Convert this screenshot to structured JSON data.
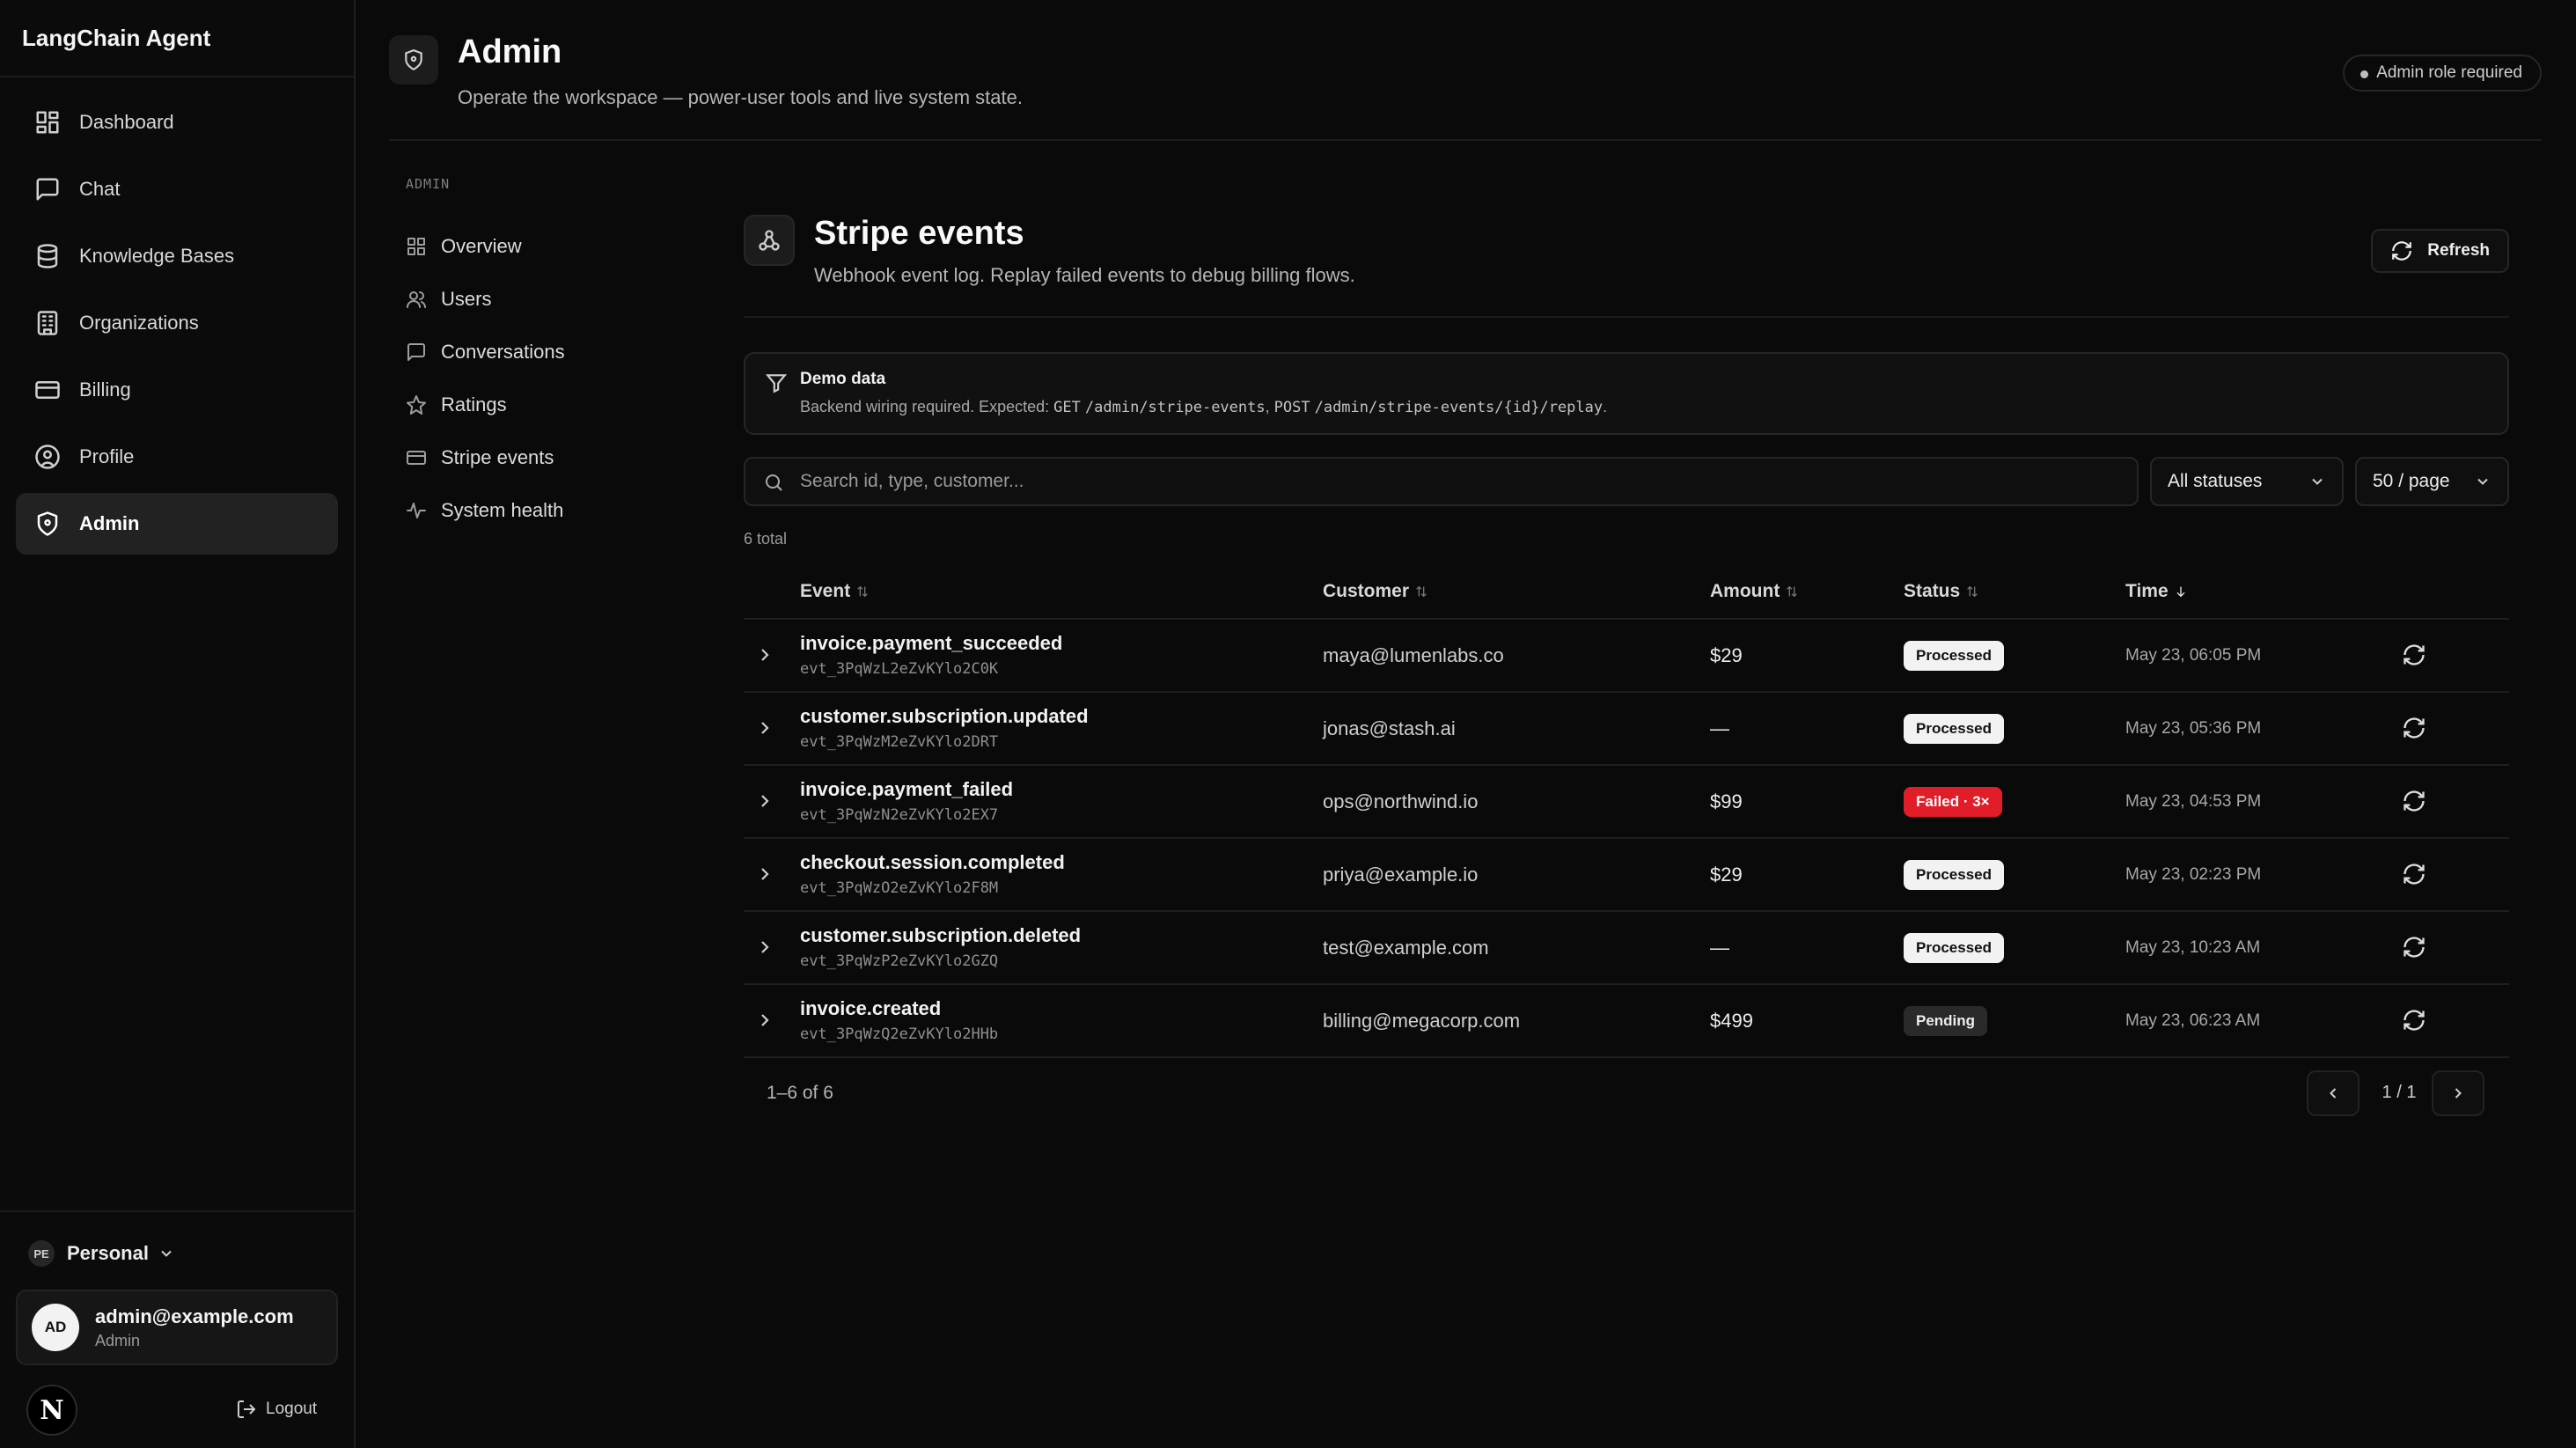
{
  "app": {
    "title": "LangChain Agent"
  },
  "sidebar": {
    "items": [
      {
        "label": "Dashboard",
        "icon": "dashboard-icon"
      },
      {
        "label": "Chat",
        "icon": "chat-icon"
      },
      {
        "label": "Knowledge Bases",
        "icon": "database-icon"
      },
      {
        "label": "Organizations",
        "icon": "building-icon"
      },
      {
        "label": "Billing",
        "icon": "credit-card-icon"
      },
      {
        "label": "Profile",
        "icon": "user-circle-icon"
      },
      {
        "label": "Admin",
        "icon": "shield-icon",
        "active": true
      }
    ],
    "workspace": {
      "badge": "PE",
      "name": "Personal"
    },
    "user": {
      "initials": "AD",
      "email": "admin@example.com",
      "role": "Admin"
    },
    "logo": "N",
    "logout": "Logout"
  },
  "header": {
    "title": "Admin",
    "subtitle": "Operate the workspace — power-user tools and live system state.",
    "role_pill": "Admin role required"
  },
  "admin_nav": {
    "label": "ADMIN",
    "items": [
      {
        "label": "Overview",
        "icon": "grid-icon"
      },
      {
        "label": "Users",
        "icon": "users-icon"
      },
      {
        "label": "Conversations",
        "icon": "message-icon"
      },
      {
        "label": "Ratings",
        "icon": "star-icon"
      },
      {
        "label": "Stripe events",
        "icon": "card-icon"
      },
      {
        "label": "System health",
        "icon": "activity-icon"
      }
    ]
  },
  "section": {
    "title": "Stripe events",
    "subtitle": "Webhook event log. Replay failed events to debug billing flows.",
    "refresh": "Refresh"
  },
  "notice": {
    "title": "Demo data",
    "prefix": "Backend wiring required. Expected: ",
    "get_method": "GET",
    "get_path": "/admin/stripe-events",
    "sep": ", ",
    "post_method": "POST",
    "post_path": "/admin/stripe-events/{id}/replay",
    "suffix": "."
  },
  "filters": {
    "search_placeholder": "Search id, type, customer...",
    "status": "All statuses",
    "page_size": "50 / page"
  },
  "total": "6 total",
  "table": {
    "columns": {
      "event": "Event",
      "customer": "Customer",
      "amount": "Amount",
      "status": "Status",
      "time": "Time"
    },
    "rows": [
      {
        "type": "invoice.payment_succeeded",
        "id": "evt_3PqWzL2eZvKYlo2C0K",
        "customer": "maya@lumenlabs.co",
        "amount": "$29",
        "status": "Processed",
        "status_kind": "processed",
        "time": "May 23, 06:05 PM"
      },
      {
        "type": "customer.subscription.updated",
        "id": "evt_3PqWzM2eZvKYlo2DRT",
        "customer": "jonas@stash.ai",
        "amount": "—",
        "status": "Processed",
        "status_kind": "processed",
        "time": "May 23, 05:36 PM"
      },
      {
        "type": "invoice.payment_failed",
        "id": "evt_3PqWzN2eZvKYlo2EX7",
        "customer": "ops@northwind.io",
        "amount": "$99",
        "status": "Failed · 3×",
        "status_kind": "failed",
        "time": "May 23, 04:53 PM"
      },
      {
        "type": "checkout.session.completed",
        "id": "evt_3PqWzO2eZvKYlo2F8M",
        "customer": "priya@example.io",
        "amount": "$29",
        "status": "Processed",
        "status_kind": "processed",
        "time": "May 23, 02:23 PM"
      },
      {
        "type": "customer.subscription.deleted",
        "id": "evt_3PqWzP2eZvKYlo2GZQ",
        "customer": "test@example.com",
        "amount": "—",
        "status": "Processed",
        "status_kind": "processed",
        "time": "May 23, 10:23 AM"
      },
      {
        "type": "invoice.created",
        "id": "evt_3PqWzQ2eZvKYlo2HHb",
        "customer": "billing@megacorp.com",
        "amount": "$499",
        "status": "Pending",
        "status_kind": "pending",
        "time": "May 23, 06:23 AM"
      }
    ]
  },
  "pagination": {
    "range": "1–6 of 6",
    "page": "1 / 1"
  },
  "colors": {
    "background": "#0a0a0a",
    "failed": "#e11d2a",
    "processed": "#f2f2f2"
  }
}
